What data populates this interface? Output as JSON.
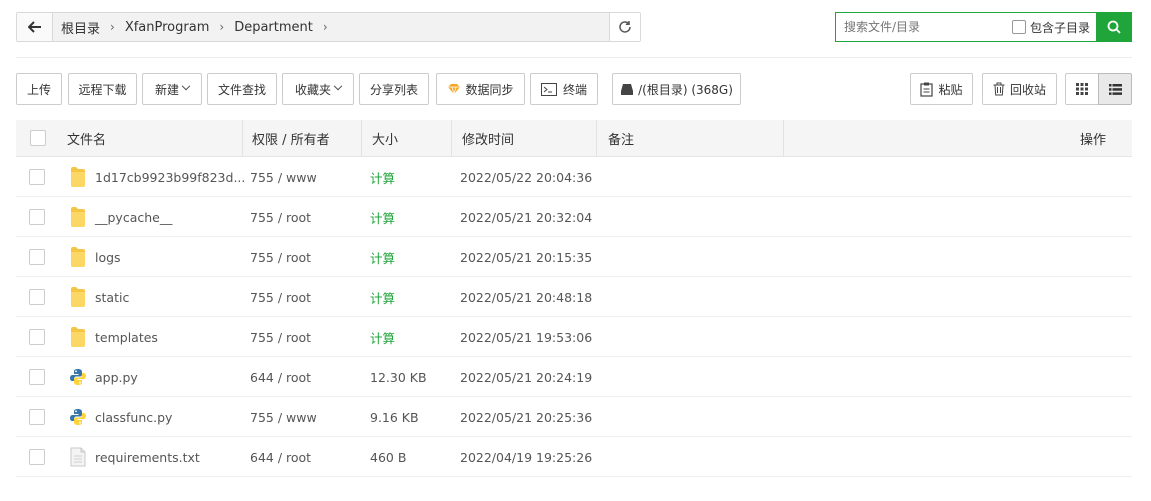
{
  "breadcrumb": [
    "根目录",
    "XfanProgram",
    "Department"
  ],
  "search": {
    "placeholder": "搜索文件/目录",
    "subdir_label": "包含子目录"
  },
  "toolbar": {
    "upload": "上传",
    "remote_download": "远程下载",
    "new": "新建",
    "file_search": "文件查找",
    "favorites": "收藏夹",
    "share_list": "分享列表",
    "data_sync": "数据同步",
    "terminal": "终端",
    "disk": "/(根目录) (368G)",
    "paste": "粘贴",
    "recycle_bin": "回收站"
  },
  "table": {
    "headers": {
      "name": "文件名",
      "perm": "权限 / 所有者",
      "size": "大小",
      "mtime": "修改时间",
      "remark": "备注",
      "action": "操作"
    },
    "rows": [
      {
        "icon": "folder-icon",
        "name": "1d17cb9923b99f823d...",
        "perm": "755 / www",
        "size": "计算",
        "mtime": "2022/05/22 20:04:36"
      },
      {
        "icon": "folder-icon",
        "name": "__pycache__",
        "perm": "755 / root",
        "size": "计算",
        "mtime": "2022/05/21 20:32:04"
      },
      {
        "icon": "folder-icon",
        "name": "logs",
        "perm": "755 / root",
        "size": "计算",
        "mtime": "2022/05/21 20:15:35"
      },
      {
        "icon": "folder-icon",
        "name": "static",
        "perm": "755 / root",
        "size": "计算",
        "mtime": "2022/05/21 20:48:18"
      },
      {
        "icon": "folder-icon",
        "name": "templates",
        "perm": "755 / root",
        "size": "计算",
        "mtime": "2022/05/21 19:53:06"
      },
      {
        "icon": "python-file-icon",
        "name": "app.py",
        "perm": "644 / root",
        "size": "12.30 KB",
        "mtime": "2022/05/21 20:24:19"
      },
      {
        "icon": "python-file-icon",
        "name": "classfunc.py",
        "perm": "755 / www",
        "size": "9.16 KB",
        "mtime": "2022/05/21 20:25:36"
      },
      {
        "icon": "text-file-icon",
        "name": "requirements.txt",
        "perm": "644 / root",
        "size": "460 B",
        "mtime": "2022/04/19 19:25:26"
      }
    ]
  },
  "colors": {
    "accent": "#20a53a",
    "folder": "#f5c645",
    "python_blue": "#3776ab",
    "python_yellow": "#ffd43b"
  }
}
